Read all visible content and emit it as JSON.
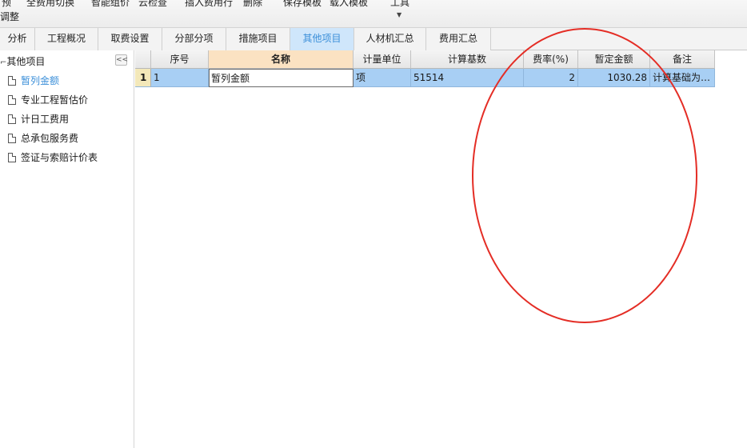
{
  "toolbar": {
    "yu": "预",
    "tiaozheng": "调整",
    "items": [
      "全费用切换",
      "智能组价",
      "云检查",
      "插入费用行",
      "删除",
      "保存模板",
      "载入模板",
      "工具"
    ],
    "dropdown_glyph": "▼"
  },
  "tabs": [
    "分析",
    "工程概况",
    "取费设置",
    "分部分项",
    "措施项目",
    "其他项目",
    "人材机汇总",
    "费用汇总"
  ],
  "active_tab": "其他项目",
  "tree": {
    "collapse_label": "<<",
    "root_label": "其他项目",
    "items": [
      "暂列金额",
      "专业工程暂估价",
      "计日工费用",
      "总承包服务费",
      "签证与索赔计价表"
    ],
    "selected": "暂列金额"
  },
  "grid": {
    "columns": [
      "序号",
      "名称",
      "计量单位",
      "计算基数",
      "费率(%)",
      "暂定金额",
      "备注"
    ],
    "rows": [
      {
        "row_number": "1",
        "seq": "1",
        "name": "暂列金额",
        "unit": "项",
        "base": "51514",
        "rate": "2",
        "amount": "1030.28",
        "remark": "计算基础为…"
      }
    ]
  },
  "colors": {
    "active_tab_bg": "#cfe6fb",
    "active_tab_text": "#3b8fd9",
    "selected_row": "#a8cff4",
    "name_header": "#fbe2c2",
    "annotation": "#e42d25"
  }
}
